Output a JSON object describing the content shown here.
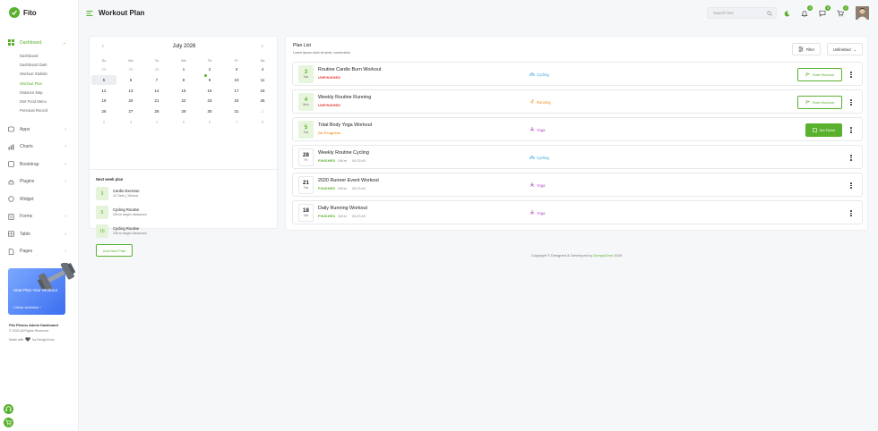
{
  "app": {
    "name": "Fito"
  },
  "colors": {
    "accent": "#59b12e",
    "unfinished": "#e0342d",
    "in_progress": "#f08c1e",
    "cycling": "#3aa3dd",
    "running": "#f08c1e",
    "yoga": "#b447c9"
  },
  "header": {
    "title": "Workout Plan",
    "search_placeholder": "Search here",
    "notifications": [
      {
        "icon": "bell-icon",
        "count": "3"
      },
      {
        "icon": "chat-icon",
        "count": "5"
      },
      {
        "icon": "cart-icon",
        "count": "2"
      }
    ]
  },
  "sidebar": {
    "menu": [
      {
        "label": "Dashboard",
        "icon": "dashboard-icon",
        "active": true,
        "children": [
          {
            "label": "Dashboard"
          },
          {
            "label": "Dashboard Dark"
          },
          {
            "label": "Workout Statistic"
          },
          {
            "label": "Workout Plan",
            "active": true
          },
          {
            "label": "Distance Map"
          },
          {
            "label": "Diet Food Menu"
          },
          {
            "label": "Personal Record"
          }
        ]
      },
      {
        "label": "Apps",
        "icon": "apps-icon"
      },
      {
        "label": "Charts",
        "icon": "chart-icon"
      },
      {
        "label": "Bootstrap",
        "icon": "bootstrap-icon"
      },
      {
        "label": "Plugins",
        "icon": "plugin-icon"
      },
      {
        "label": "Widget",
        "icon": "widget-icon"
      },
      {
        "label": "Forms",
        "icon": "form-icon"
      },
      {
        "label": "Table",
        "icon": "table-icon"
      },
      {
        "label": "Pages",
        "icon": "pages-icon"
      }
    ],
    "promo": {
      "title": "Start Plan Your Workout",
      "link": "Check schedule"
    },
    "footer": {
      "brand": "Fito Fitness Admin Dashboard",
      "rights": "© 2020 All Rights Reserved",
      "made_with": "Made with",
      "by": "by DexignZone"
    }
  },
  "calendar": {
    "month": "July 2026",
    "weekdays": [
      "Su",
      "Mo",
      "Tu",
      "We",
      "Th",
      "Fr",
      "Sa"
    ],
    "weeks": [
      [
        "26",
        "29",
        "30",
        "1",
        "2",
        "3",
        "4"
      ],
      [
        "5",
        "6",
        "7",
        "8",
        "9",
        "10",
        "11"
      ],
      [
        "12",
        "13",
        "14",
        "15",
        "16",
        "17",
        "18"
      ],
      [
        "19",
        "20",
        "21",
        "22",
        "23",
        "24",
        "25"
      ],
      [
        "26",
        "27",
        "28",
        "29",
        "30",
        "31",
        "1"
      ],
      [
        "2",
        "3",
        "4",
        "5",
        "6",
        "7",
        "8"
      ]
    ],
    "selected": "5"
  },
  "next_week": {
    "title": "Next week plan",
    "items": [
      {
        "num": "3",
        "name": "Cardio Exercise",
        "meta": "12 Sets | 15mins"
      },
      {
        "num": "5",
        "name": "Cycling Routine",
        "meta": "20Km target distances"
      },
      {
        "num": "16",
        "name": "Cycling Routine",
        "meta": "20Km target distances"
      }
    ],
    "add_button": "Add New Plan"
  },
  "plan_list": {
    "title": "Plan List",
    "subtitle": "Lorem ipsum dolor sit amet, consectetur",
    "filter_label": "Filter",
    "status_label": "Unfinished",
    "rows": [
      {
        "date": "3",
        "day": "Sun",
        "name": "Routine Cardio Burn Workout",
        "status": "UNFINISHED",
        "status_class": "unfinished",
        "distance": "",
        "time": "",
        "type": "Cycling",
        "type_class": "cycling",
        "action": "Start Workout",
        "action_style": "outline",
        "date_style": "green"
      },
      {
        "date": "4",
        "day": "Mon",
        "name": "Weekly Routine Running",
        "status": "UNFINISHED",
        "status_class": "unfinished",
        "distance": "",
        "time": "",
        "type": "Running",
        "type_class": "running",
        "action": "Start Workout",
        "action_style": "outline",
        "date_style": "green"
      },
      {
        "date": "5",
        "day": "Tue",
        "name": "Total Body Yoga Workout",
        "status": "On Progress",
        "status_class": "progress",
        "distance": "",
        "time": "",
        "type": "Yoga",
        "type_class": "yoga",
        "action": "Set Finish",
        "action_style": "filled",
        "date_style": "green"
      },
      {
        "date": "28",
        "day": "Fri",
        "name": "Weekly Routine Cycling",
        "status": "FINISHED",
        "status_class": "finished",
        "distance": "24Km",
        "time": "00:23:45",
        "type": "Cycling",
        "type_class": "cycling",
        "action": "",
        "action_style": "",
        "date_style": "white"
      },
      {
        "date": "21",
        "day": "Tue",
        "name": "2020 Runner Event Workout",
        "status": "FINISHED",
        "status_class": "finished",
        "distance": "24Km",
        "time": "00:23:45",
        "type": "Yoga",
        "type_class": "yoga",
        "action": "",
        "action_style": "",
        "date_style": "white"
      },
      {
        "date": "18",
        "day": "Sat",
        "name": "Daily Running Workout",
        "status": "FINISHED",
        "status_class": "finished",
        "distance": "24Km",
        "time": "00:23:45",
        "type": "Yoga",
        "type_class": "yoga",
        "action": "",
        "action_style": "",
        "date_style": "white"
      }
    ]
  },
  "copyright": {
    "prefix": "Copyright © Designed & Developed by",
    "brand": "DexignZone",
    "year": "2026"
  }
}
